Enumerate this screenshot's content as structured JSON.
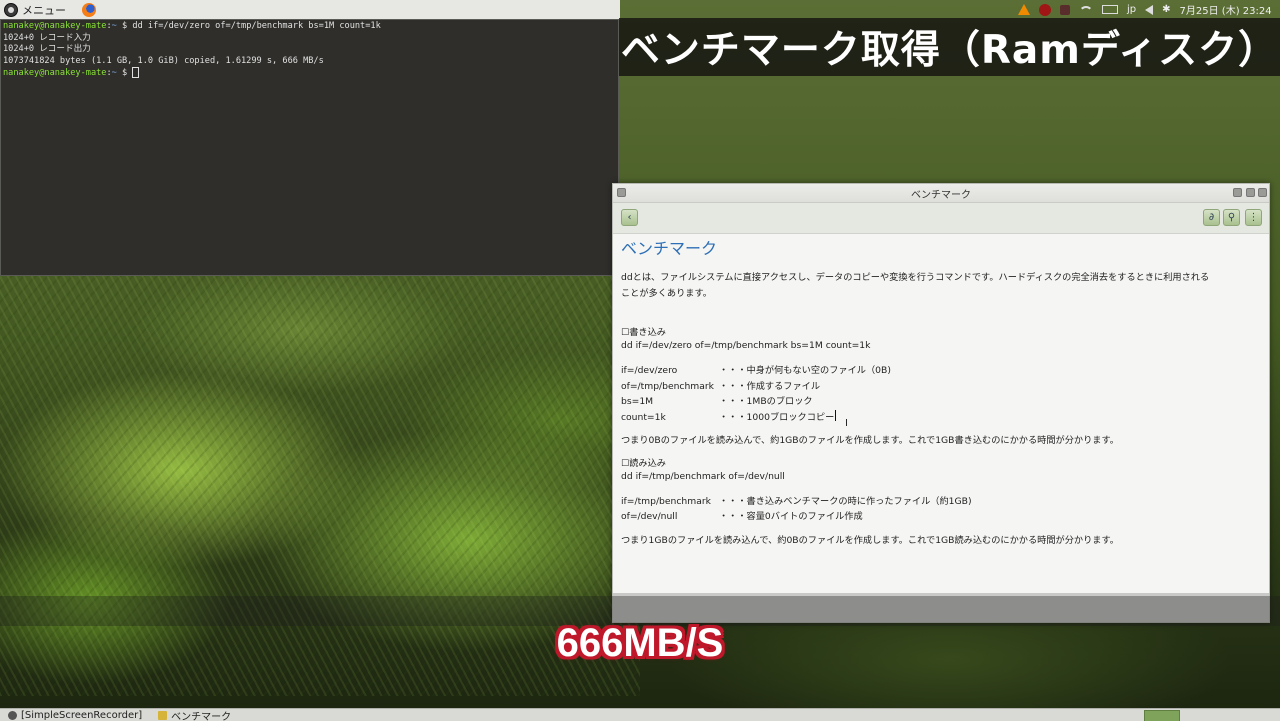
{
  "top_panel": {
    "menu_label": "メニュー",
    "tray": {
      "lang": "jp",
      "datetime": "7月25日 (木) 23:24"
    }
  },
  "overlay_title": "ベンチマーク取得（Ramディスク）",
  "terminal": {
    "prompt_user": "nanakey@nanakey-mate",
    "prompt_path": "~",
    "prompt_suffix": " $ ",
    "command": "dd if=/dev/zero of=/tmp/benchmark bs=1M count=1k",
    "output": [
      "1024+0 レコード入力",
      "1024+0 レコード出力",
      "1073741824 bytes (1.1 GB, 1.0 GiB) copied, 1.61299 s, 666 MB/s"
    ]
  },
  "note_window": {
    "title": "ベンチマーク",
    "heading": "ベンチマーク",
    "intro_1": "ddとは、ファイルシステムに直接アクセスし、データのコピーや変換を行うコマンドです。ハードディスクの完全消去をするときに利用される",
    "intro_2": "ことが多くあります。",
    "write_heading": "☐書き込み",
    "write_cmd": "dd if=/dev/zero of=/tmp/benchmark bs=1M count=1k",
    "write_params": [
      {
        "k": "if=/dev/zero",
        "v": "・・・中身が何もない空のファイル（0B)"
      },
      {
        "k": "of=/tmp/benchmark",
        "v": "・・・作成するファイル"
      },
      {
        "k": "bs=1M",
        "v": "・・・1MBのブロック"
      },
      {
        "k": "count=1k",
        "v": "・・・1000ブロックコピー"
      }
    ],
    "write_summary": "つまり0Bのファイルを読み込んで、約1GBのファイルを作成します。これで1GB書き込むのにかかる時間が分かります。",
    "read_heading": "☐読み込み",
    "read_cmd": "dd if=/tmp/benchmark of=/dev/null",
    "read_params": [
      {
        "k": "if=/tmp/benchmark",
        "v": "・・・書き込みベンチマークの時に作ったファイル（約1GB)"
      },
      {
        "k": "of=/dev/null",
        "v": "・・・容量0バイトのファイル作成"
      }
    ],
    "read_summary": "つまり1GBのファイルを読み込んで、約0Bのファイルを作成します。これで1GB読み込むのにかかる時間が分かります。"
  },
  "subtitle": "666MB/S",
  "taskbar": {
    "items": [
      "[SimpleScreenRecorder]",
      "ベンチマーク"
    ]
  }
}
